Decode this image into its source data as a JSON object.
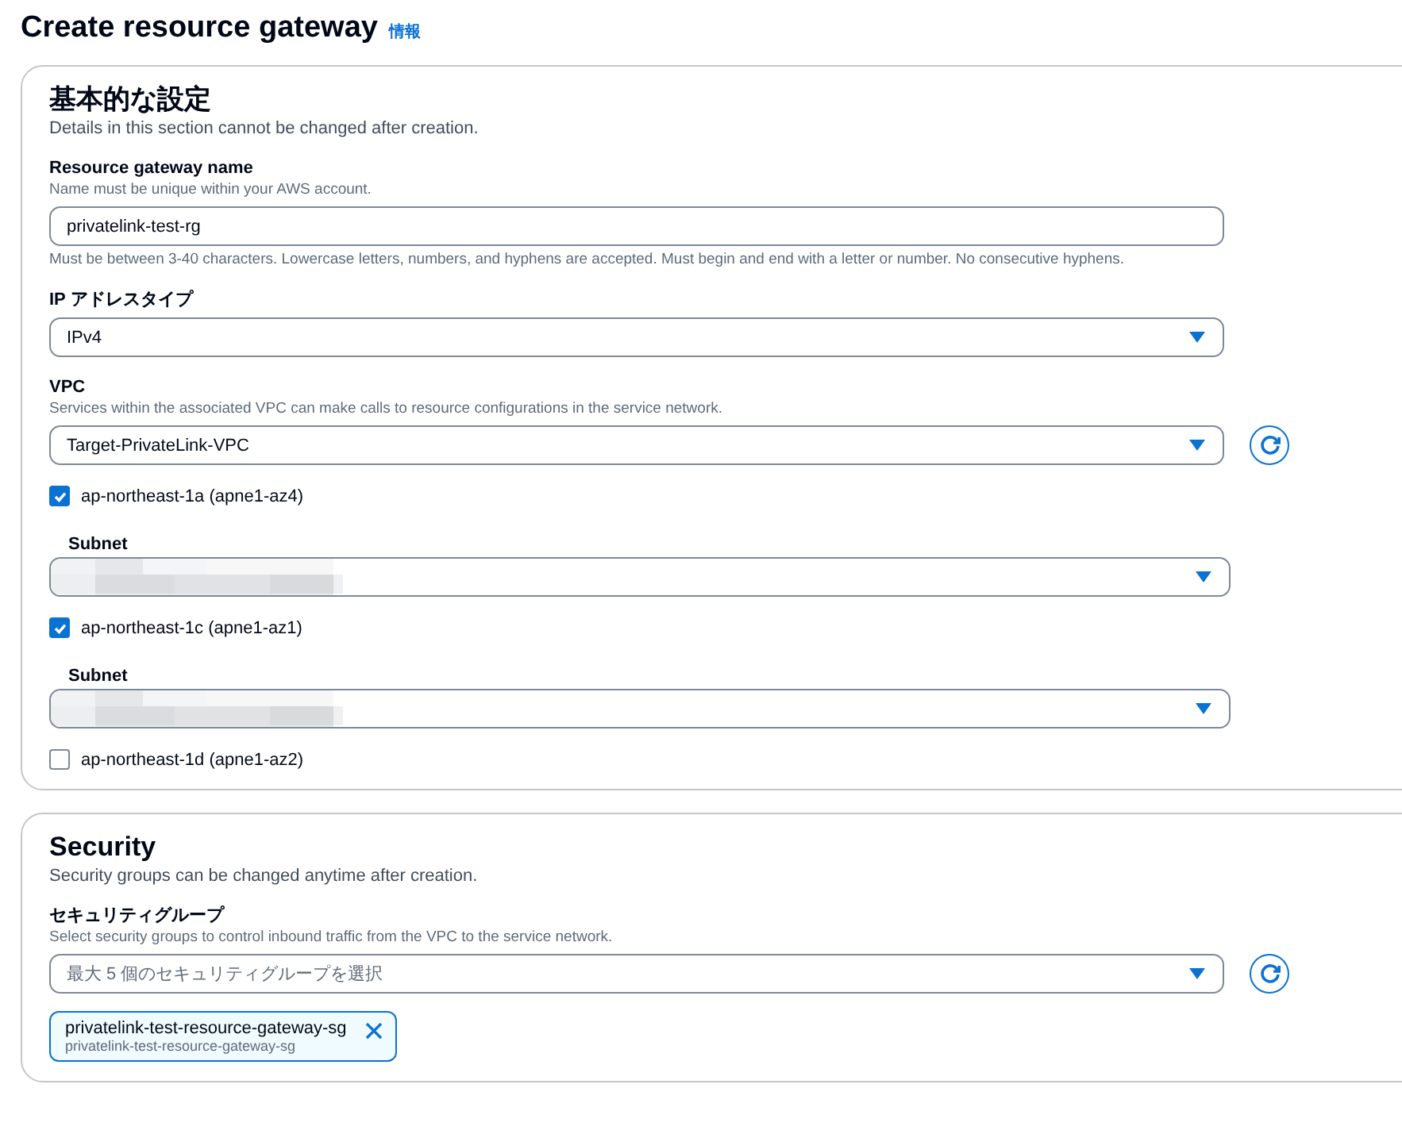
{
  "page": {
    "title": "Create resource gateway",
    "info_link": "情報"
  },
  "sections": [
    {
      "title": "基本的な設定",
      "description": "Details in this section cannot be changed after creation.",
      "fields": [
        {
          "kind": "text",
          "label": "Resource gateway name",
          "hint": "Name must be unique within your AWS account.",
          "value": "privatelink-test-rg",
          "constraint": "Must be between 3-40 characters. Lowercase letters, numbers, and hyphens are accepted. Must begin and end with a letter or number. No consecutive hyphens."
        },
        {
          "kind": "select",
          "label": "IP アドレスタイプ",
          "value": "IPv4",
          "refresh": false
        },
        {
          "kind": "select",
          "label": "VPC",
          "hint": "Services within the associated VPC can make calls to resource configurations in the service network.",
          "value": "Target-PrivateLink-VPC",
          "refresh": true
        },
        {
          "kind": "checkbox",
          "label": "ap-northeast-1a (apne1-az4)",
          "checked": true
        },
        {
          "kind": "subnet",
          "label": "Subnet"
        },
        {
          "kind": "checkbox",
          "label": "ap-northeast-1c (apne1-az1)",
          "checked": true
        },
        {
          "kind": "subnet",
          "label": "Subnet"
        },
        {
          "kind": "checkbox",
          "label": "ap-northeast-1d (apne1-az2)",
          "checked": false
        }
      ]
    },
    {
      "title": "Security",
      "description": "Security groups can be changed anytime after creation.",
      "fields": [
        {
          "kind": "select",
          "label": "セキュリティグループ",
          "hint": "Select security groups to control inbound traffic from the VPC to the service network.",
          "placeholder": "最大 5 個のセキュリティグループを選択",
          "refresh": true
        },
        {
          "kind": "token",
          "label": "privatelink-test-resource-gateway-sg",
          "sublabel": "privatelink-test-resource-gateway-sg"
        }
      ]
    }
  ]
}
